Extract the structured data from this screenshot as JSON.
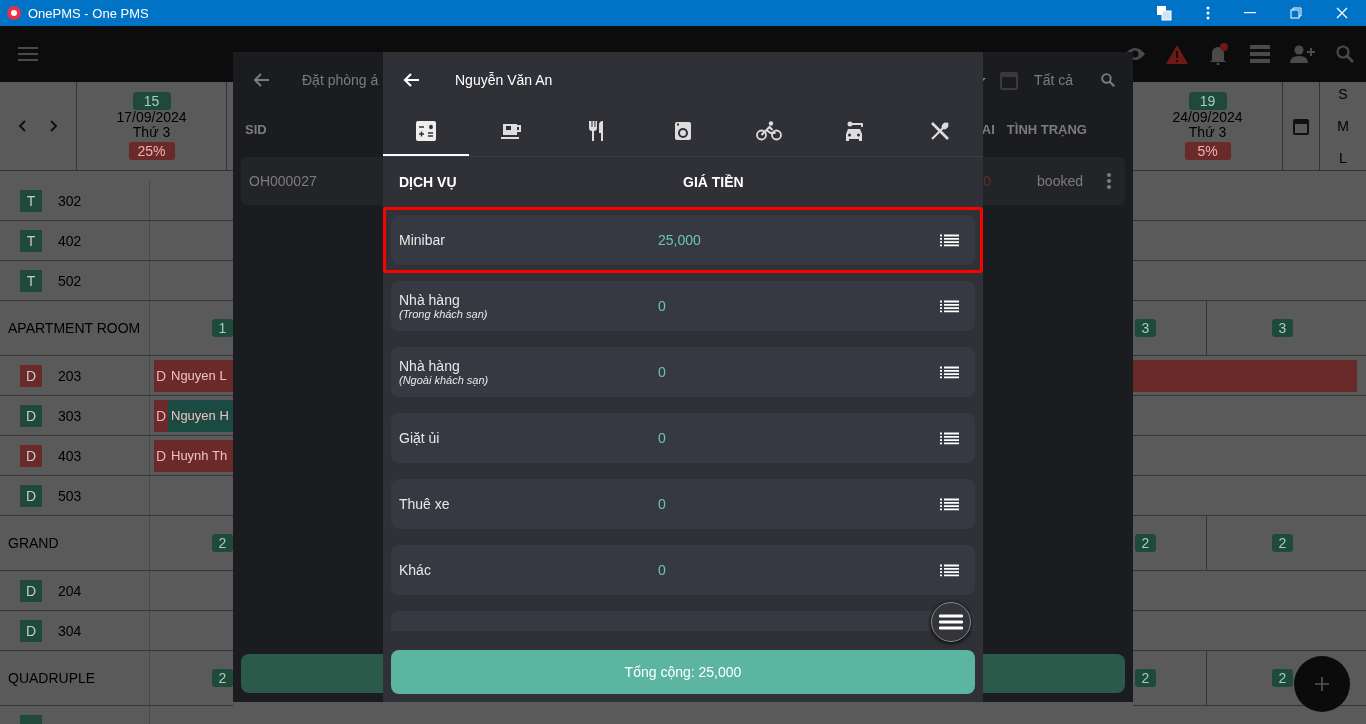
{
  "window": {
    "title": "OnePMS - One PMS"
  },
  "calendar": {
    "left_date": {
      "day": "15",
      "date": "17/09/2024",
      "weekday": "Thứ 3",
      "occupancy": "25%"
    },
    "right_date": {
      "day": "19",
      "date": "24/09/2024",
      "weekday": "Thứ 3",
      "occupancy": "5%"
    },
    "sizes": [
      "S",
      "M",
      "L"
    ],
    "rows": [
      {
        "kind": "room",
        "code": "T",
        "color": "#1f4a3b",
        "number": "302"
      },
      {
        "kind": "room",
        "code": "T",
        "color": "#1f4a3b",
        "number": "402"
      },
      {
        "kind": "room",
        "code": "T",
        "color": "#1f4a3b",
        "number": "502"
      },
      {
        "kind": "group",
        "name": "APARTMENT ROOM",
        "counts": [
          "1",
          "3",
          "3"
        ]
      },
      {
        "kind": "room",
        "code": "D",
        "color": "#6b2a2a",
        "number": "203",
        "booking": {
          "code": "D",
          "guest": "Nguyen L",
          "color": "#6b2a2a",
          "continues": true
        }
      },
      {
        "kind": "room",
        "code": "D",
        "color": "#1f4a3b",
        "number": "303",
        "booking": {
          "code": "D",
          "guest": "Nguyen H",
          "color": "#1a4a42",
          "continues": false
        }
      },
      {
        "kind": "room",
        "code": "D",
        "color": "#6b2a2a",
        "number": "403",
        "booking": {
          "code": "D",
          "guest": "Huynh Th",
          "color": "#6b2a2a",
          "continues": false
        }
      },
      {
        "kind": "room",
        "code": "D",
        "color": "#1f4a3b",
        "number": "503"
      },
      {
        "kind": "group",
        "name": "GRAND",
        "counts": [
          "2",
          "2",
          "2"
        ]
      },
      {
        "kind": "room",
        "code": "D",
        "color": "#1f4a3b",
        "number": "204"
      },
      {
        "kind": "room",
        "code": "D",
        "color": "#1f4a3b",
        "number": "304"
      },
      {
        "kind": "group",
        "name": "QUADRUPLE",
        "counts": [
          "2",
          "2",
          "2"
        ]
      },
      {
        "kind": "room",
        "color": "#1f4a3b"
      }
    ]
  },
  "booking_dialog": {
    "title": "Đặt phòng á",
    "filter": "Tất cả",
    "columns": [
      "SID",
      "AI",
      "TÌNH TRẠNG"
    ],
    "rows": [
      {
        "sid": "OH000027",
        "column_2": "0",
        "status": "booked"
      }
    ]
  },
  "service_dialog": {
    "guest": "Nguyễn Văn An",
    "tabs": [
      {
        "kind": "calculator",
        "selected": true
      },
      {
        "kind": "coffee",
        "selected": false
      },
      {
        "kind": "restaurant",
        "selected": false
      },
      {
        "kind": "laundry",
        "selected": false
      },
      {
        "kind": "bicycle",
        "selected": false
      },
      {
        "kind": "car",
        "selected": false
      },
      {
        "kind": "dining",
        "selected": false
      }
    ],
    "columns": [
      "DỊCH VỤ",
      "GIÁ TIỀN"
    ],
    "items": [
      {
        "name": "Minibar",
        "amount": "25,000",
        "highlighted": true
      },
      {
        "name": "Nhà hàng",
        "note": "(Trong khách sạn)",
        "amount": "0",
        "highlighted": false
      },
      {
        "name": "Nhà hàng",
        "note": "(Ngoài khách sạn)",
        "amount": "0",
        "highlighted": false
      },
      {
        "name": "Giặt ủi",
        "amount": "0",
        "highlighted": false
      },
      {
        "name": "Thuê xe",
        "amount": "0",
        "highlighted": false
      },
      {
        "name": "Khác",
        "amount": "0",
        "highlighted": false
      }
    ],
    "total": "Tổng cộng: 25,000"
  }
}
